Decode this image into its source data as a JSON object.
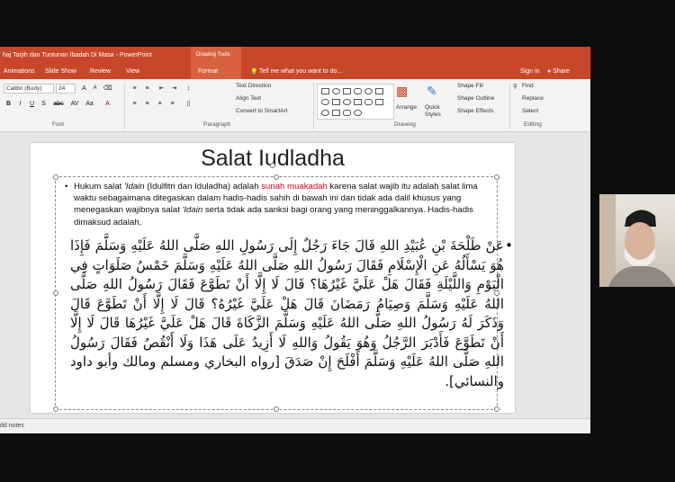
{
  "app": {
    "title": "haj Tarjih dan Tuntunan Ibadah Di Masa - PowerPoint",
    "context_tab": "Drawing Tools"
  },
  "tabs": [
    {
      "label": "Animations"
    },
    {
      "label": "Slide Show"
    },
    {
      "label": "Review"
    },
    {
      "label": "View"
    },
    {
      "label": "Format"
    }
  ],
  "tellme": "Tell me what you want to do...",
  "account": {
    "signin": "Sign in",
    "share": "Share"
  },
  "ribbon": {
    "font_name": "Calibri (Body)",
    "font_size": "24",
    "text_direction": "Text Direction",
    "align_text": "Align Text",
    "convert_smartart": "Convert to SmartArt",
    "arrange": "Arrange",
    "quick_styles": "Quick Styles",
    "shape_fill": "Shape Fill",
    "shape_outline": "Shape Outline",
    "shape_effects": "Shape Effects",
    "find": "Find",
    "replace": "Replace",
    "select": "Select",
    "groups": {
      "font": "Font",
      "paragraph": "Paragraph",
      "drawing": "Drawing",
      "editing": "Editing"
    }
  },
  "slide": {
    "title": "Salat Iudladha",
    "bullet1": {
      "p1": "Hukum salat ",
      "idain1": "'Idain",
      "p2": " (Idulfitri dan Iduladha) adalah ",
      "sunah": "sunah muakadah",
      "p3": "  karena salat wajib itu adalah salat lima waktu sebagaimana ditegaskan dalam hadis-hadis sahih di bawah ini dan tidak ada dalil khusus yang menegaskan wajibnya salat ",
      "idain2": "'Idain",
      "p4": " serta tidak ada sanksi bagi orang yang meninggalkannya. Hadis-hadis dimaksud adalah,"
    },
    "hadith": "عَنْ طَلْحَةَ بْنِ عُبَيْدِ اللهِ قَالَ جَاءَ رَجُلٌ إِلَى رَسُولِ اللهِ صَلَّى اللهُ عَلَيْهِ وَسَلَّمَ فَإِذَا هُوَ يَسْأَلُهُ عَنِ الْإِسْلَامِ فَقَالَ رَسُولُ اللهِ صَلَّى اللهُ عَلَيْهِ وَسَلَّمَ خَمْسُ صَلَوَاتٍ فِي الْيَوْمِ وَاللَّيْلَةِ فَقَالَ هَلْ عَلَيَّ غَيْرُهَا؟ قَالَ لَا إِلَّا أَنْ تَطَوَّعَ فَقَالَ رَسُولُ اللهِ صَلَّى اللهُ عَلَيْهِ وَسَلَّمَ وَصِيَامُ رَمَضَانَ قَالَ هَلْ عَلَيَّ غَيْرُهُ؟ قَالَ لَا إِلَّا أَنْ تَطَوَّعَ قَالَ وَذَكَرَ لَهُ رَسُولُ اللهِ صَلَّى اللهُ عَلَيْهِ وَسَلَّمَ الزَّكَاةَ قَالَ هَلْ عَلَيَّ غَيْرُهَا قَالَ لَا إِلَّا أَنْ تَطَوَّعَ فَأَدْبَرَ الرَّجُلُ وَهُوَ يَقُولُ وَاللهِ لَا أَزِيدُ عَلَى هَذَا وَلَا أَنْقُصُ فَقَالَ رَسُولُ اللهِ صَلَّى اللهُ عَلَيْهِ وَسَلَّمَ أَفْلَحَ إِنْ صَدَقَ [رواه البخاري ومسلم ومالك وأبو داود والنسائي]."
  },
  "status": {
    "notes": "dd notes"
  }
}
